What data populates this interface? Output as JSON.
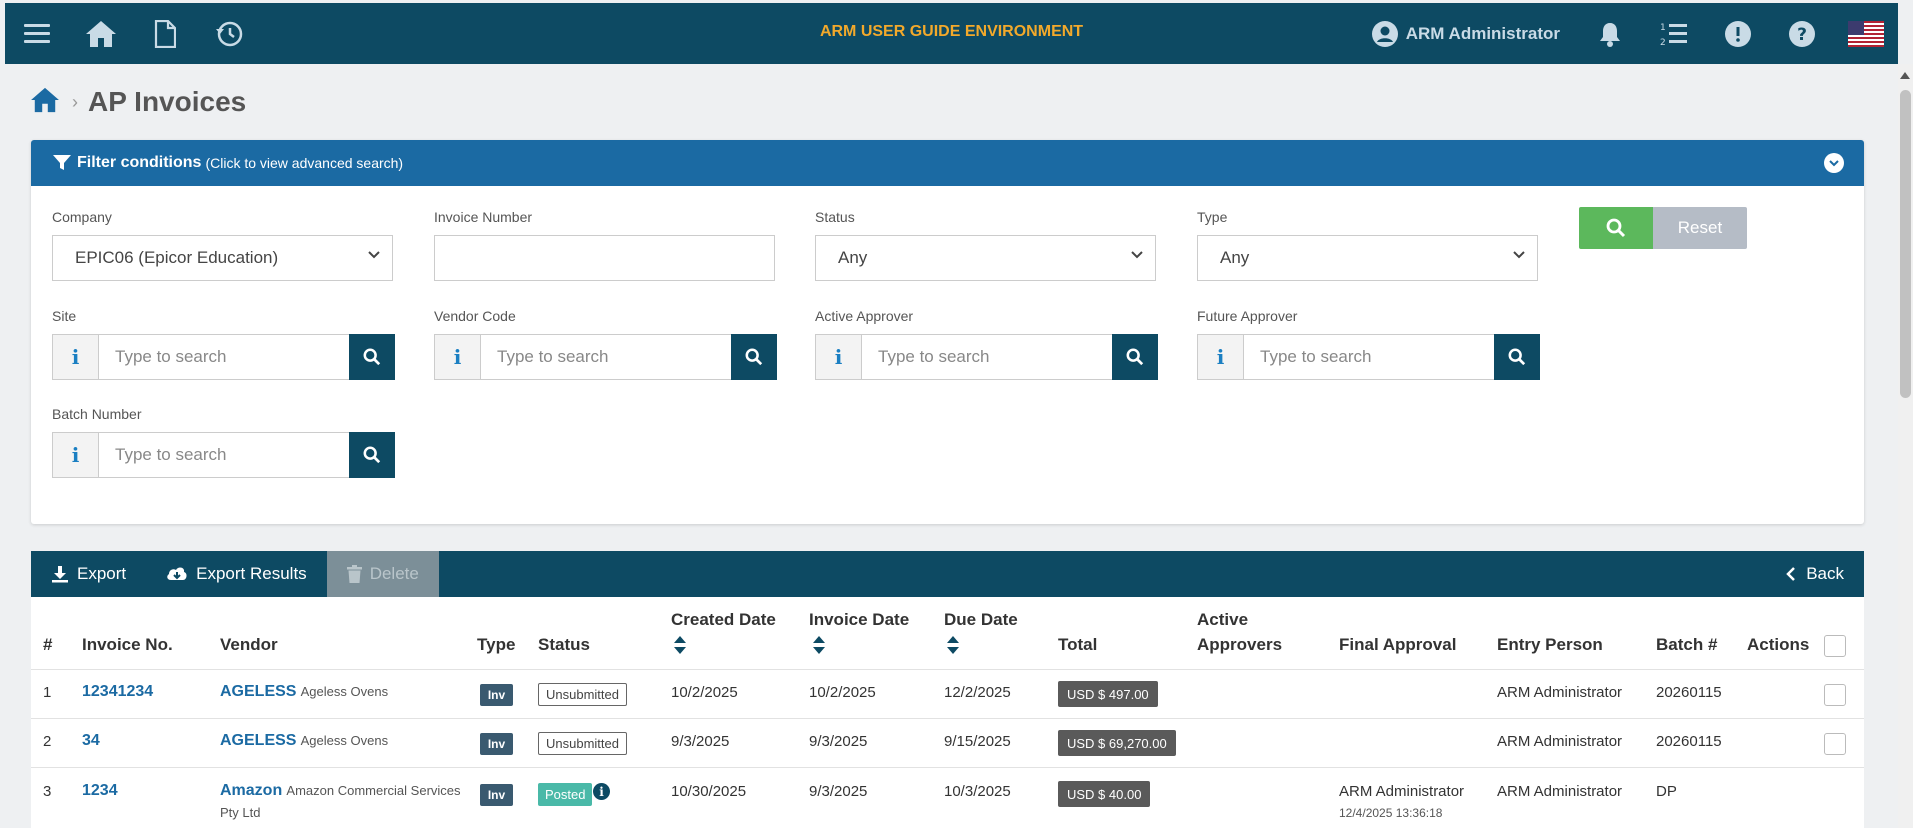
{
  "topbar": {
    "env_title": "ARM USER GUIDE ENVIRONMENT",
    "user_name": "ARM Administrator"
  },
  "page": {
    "title": "AP Invoices"
  },
  "filter": {
    "title": "Filter conditions",
    "subtitle": "(Click to view advanced search)",
    "company_label": "Company",
    "company_value": "EPIC06 (Epicor Education)",
    "invoice_number_label": "Invoice Number",
    "invoice_number_value": "",
    "status_label": "Status",
    "status_value": "Any",
    "type_label": "Type",
    "type_value": "Any",
    "site_label": "Site",
    "vendor_code_label": "Vendor Code",
    "active_approver_label": "Active Approver",
    "future_approver_label": "Future Approver",
    "batch_number_label": "Batch Number",
    "search_placeholder": "Type to search",
    "info_glyph": "i",
    "reset_label": "Reset"
  },
  "toolbar": {
    "export_label": "Export",
    "export_results_label": "Export Results",
    "delete_label": "Delete",
    "back_label": "Back"
  },
  "table": {
    "headers": {
      "num": "#",
      "invoice_no": "Invoice No.",
      "vendor": "Vendor",
      "type": "Type",
      "status": "Status",
      "created_date": "Created Date",
      "invoice_date": "Invoice Date",
      "due_date": "Due Date",
      "total": "Total",
      "active_approvers_1": "Active",
      "active_approvers_2": "Approvers",
      "final_approval": "Final Approval",
      "entry_person": "Entry Person",
      "batch": "Batch #",
      "actions": "Actions"
    },
    "rows": [
      {
        "num": "1",
        "invoice_no": "12341234",
        "vendor_code": "AGELESS",
        "vendor_name": "Ageless Ovens",
        "type": "Inv",
        "status": "Unsubmitted",
        "created_date": "10/2/2025",
        "invoice_date": "10/2/2025",
        "due_date": "12/2/2025",
        "total": "USD $ 497.00",
        "final_approval": "",
        "entry_person": "ARM Administrator",
        "batch": "20260115"
      },
      {
        "num": "2",
        "invoice_no": "34",
        "vendor_code": "AGELESS",
        "vendor_name": "Ageless Ovens",
        "type": "Inv",
        "status": "Unsubmitted",
        "created_date": "9/3/2025",
        "invoice_date": "9/3/2025",
        "due_date": "9/15/2025",
        "total": "USD $ 69,270.00",
        "final_approval": "",
        "entry_person": "ARM Administrator",
        "batch": "20260115"
      },
      {
        "num": "3",
        "invoice_no": "1234",
        "vendor_code": "Amazon",
        "vendor_name": "Amazon Commercial Services",
        "vendor_name_2": "Pty Ltd",
        "type": "Inv",
        "status": "Posted",
        "created_date": "10/30/2025",
        "invoice_date": "9/3/2025",
        "due_date": "10/3/2025",
        "total": "USD $ 40.00",
        "final_approval": "ARM Administrator",
        "final_approval_time": "12/4/2025 13:36:18",
        "entry_person": "ARM Administrator",
        "batch": "DP"
      }
    ]
  },
  "colors": {
    "navy": "#0d4a63",
    "filter_blue": "#1b6aa3",
    "env_orange": "#f2a92b",
    "search_green": "#5cb85c",
    "posted_teal": "#4ab9a8"
  }
}
